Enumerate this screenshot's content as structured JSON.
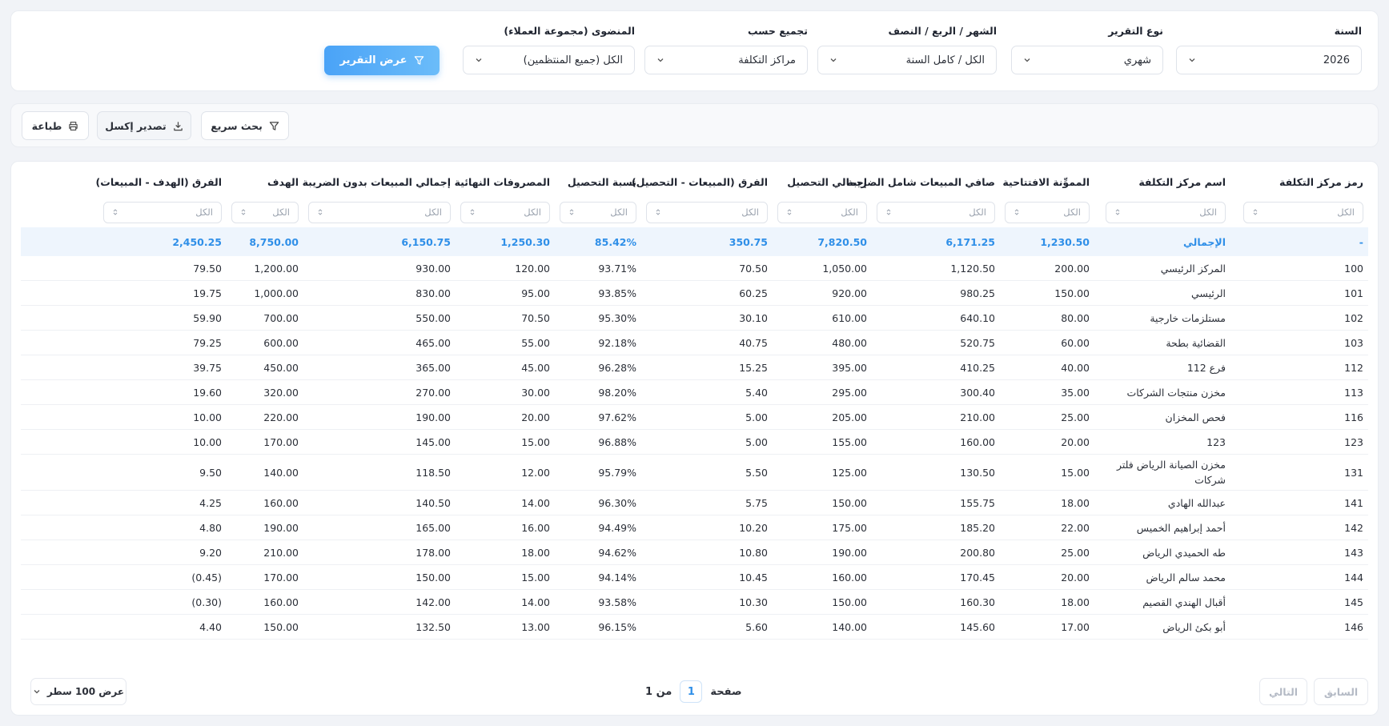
{
  "filters": {
    "year": {
      "label": "السنة",
      "value": "2026"
    },
    "report_type": {
      "label": "نوع التقرير",
      "value": "شهري"
    },
    "period": {
      "label": "الشهر / الربع / النصف",
      "value": "الكل / كامل السنة"
    },
    "group_by": {
      "label": "تجميع حسب",
      "value": "مراكز التكلفة"
    },
    "customer_group": {
      "label": "المنضوى (مجموعة العملاء)",
      "value": "الكل (جميع المنتظمين)"
    },
    "show_button": "عرض التقرير"
  },
  "toolbar": {
    "quick_search": "بحث سريع",
    "export_excel": "تصدير إكسل",
    "print": "طباعة"
  },
  "table": {
    "filter_placeholder": "الكل",
    "columns": [
      "رمز مركز التكلفة",
      "اسم مركز التكلفة",
      "المموِّنة الافتتاحية",
      "صافي المبيعات شامل الضريبة",
      "إجمالي التحصيل",
      "الفرق (المبيعات - التحصيل)",
      "نسبة التحصيل",
      "المصروفات النهائية",
      "إجمالي المبيعات بدون الضريبة",
      "الهدف",
      "الفرق (الهدف - المبيعات)"
    ],
    "total": [
      "-",
      "الإجمالي",
      "1,230.50",
      "6,171.25",
      "7,820.50",
      "350.75",
      "85.42%",
      "1,250.30",
      "6,150.75",
      "8,750.00",
      "2,450.25"
    ],
    "rows": [
      [
        "100",
        "المركز الرئيسي",
        "200.00",
        "1,120.50",
        "1,050.00",
        "70.50",
        "93.71%",
        "120.00",
        "930.00",
        "1,200.00",
        "79.50"
      ],
      [
        "101",
        "الرئيسي",
        "150.00",
        "980.25",
        "920.00",
        "60.25",
        "93.85%",
        "95.00",
        "830.00",
        "1,000.00",
        "19.75"
      ],
      [
        "102",
        "مستلزمات خارجية",
        "80.00",
        "640.10",
        "610.00",
        "30.10",
        "95.30%",
        "70.50",
        "550.00",
        "700.00",
        "59.90"
      ],
      [
        "103",
        "القضائية بطحة",
        "60.00",
        "520.75",
        "480.00",
        "40.75",
        "92.18%",
        "55.00",
        "465.00",
        "600.00",
        "79.25"
      ],
      [
        "112",
        "فرع 112",
        "40.00",
        "410.25",
        "395.00",
        "15.25",
        "96.28%",
        "45.00",
        "365.00",
        "450.00",
        "39.75"
      ],
      [
        "113",
        "مخزن منتجات الشركات",
        "35.00",
        "300.40",
        "295.00",
        "5.40",
        "98.20%",
        "30.00",
        "270.00",
        "320.00",
        "19.60"
      ],
      [
        "116",
        "فحص المخزان",
        "25.00",
        "210.00",
        "205.00",
        "5.00",
        "97.62%",
        "20.00",
        "190.00",
        "220.00",
        "10.00"
      ],
      [
        "123",
        "123",
        "20.00",
        "160.00",
        "155.00",
        "5.00",
        "96.88%",
        "15.00",
        "145.00",
        "170.00",
        "10.00"
      ],
      [
        "131",
        "مخزن الصيانة الرياض فلتر شركات",
        "15.00",
        "130.50",
        "125.00",
        "5.50",
        "95.79%",
        "12.00",
        "118.50",
        "140.00",
        "9.50"
      ],
      [
        "141",
        "عبدالله الهادي",
        "18.00",
        "155.75",
        "150.00",
        "5.75",
        "96.30%",
        "14.00",
        "140.50",
        "160.00",
        "4.25"
      ],
      [
        "142",
        "أحمد إبراهيم الخميس",
        "22.00",
        "185.20",
        "175.00",
        "10.20",
        "94.49%",
        "16.00",
        "165.00",
        "190.00",
        "4.80"
      ],
      [
        "143",
        "طه الحميدي الرياض",
        "25.00",
        "200.80",
        "190.00",
        "10.80",
        "94.62%",
        "18.00",
        "178.00",
        "210.00",
        "9.20"
      ],
      [
        "144",
        "محمد سالم الرياض",
        "20.00",
        "170.45",
        "160.00",
        "10.45",
        "94.14%",
        "15.00",
        "150.00",
        "170.00",
        "(0.45)"
      ],
      [
        "145",
        "أقبال الهندي القصيم",
        "18.00",
        "160.30",
        "150.00",
        "10.30",
        "93.58%",
        "14.00",
        "142.00",
        "160.00",
        "(0.30)"
      ],
      [
        "146",
        "أبو بكئ الرياض",
        "17.00",
        "145.60",
        "140.00",
        "5.60",
        "96.15%",
        "13.00",
        "132.50",
        "150.00",
        "4.40"
      ]
    ]
  },
  "pagination": {
    "prev": "السابق",
    "next": "التالي",
    "page_label": "صفحة",
    "current_page": "1",
    "of_label": "من 1",
    "rows_per_page": "عرض 100 سطر"
  },
  "colors": {
    "accent": "#2f8fe8",
    "button": "#4aa3f7"
  }
}
